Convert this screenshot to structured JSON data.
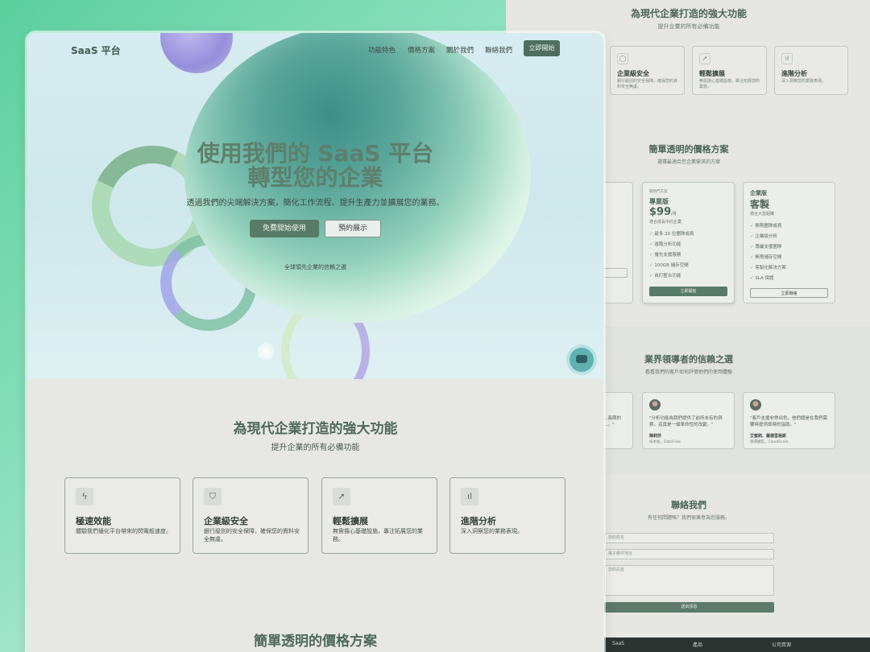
{
  "background_page": {
    "features": {
      "title": "為現代企業打造的強大功能",
      "subtitle": "提升企業的所有必備功能",
      "cards": [
        {
          "icon": "shield-icon",
          "title": "企業級安全",
          "desc": "銀行級別的安全保障，確保您的資料安全無虞。"
        },
        {
          "icon": "rocket-icon",
          "title": "輕鬆擴展",
          "desc": "無需擔心基礎設施，專注拓展您的業務。"
        },
        {
          "icon": "chart-icon",
          "title": "進階分析",
          "desc": "深入洞察您的業務表現。"
        }
      ]
    },
    "pricing": {
      "title": "簡單透明的價格方案",
      "subtitle": "選擇最適合您企業需求的方案",
      "pro": {
        "tag": "最熱門方案",
        "name": "專業版",
        "price": "$99",
        "period": "/月",
        "desc": "適合成長中的企業",
        "features": [
          "最多 20 位團隊成員",
          "進階分析功能",
          "優先支援服務",
          "100GB 儲存空間",
          "自訂整合功能"
        ],
        "cta": "立即開始"
      },
      "enterprise": {
        "name": "企業版",
        "price": "客製",
        "desc": "適合大型組織",
        "features": [
          "無限團隊成員",
          "企業級分析",
          "專屬支援團隊",
          "無限儲存空間",
          "客製化解決方案",
          "SLA 保證"
        ],
        "cta": "立即聯絡"
      }
    },
    "testimonials": {
      "title": "業界領導者的信賴之選",
      "subtitle": "看看我們的客戶如何評價他們的使用體驗",
      "partial_quote": "…長期的\n…。\"",
      "items": [
        {
          "quote": "\"分析功能為我們提供了前所未有的洞察，這真是一個革命性的改變。\"",
          "name": "陳莉莎",
          "company": "技術長，DataFlow"
        },
        {
          "quote": "\"客戶支援非常出色。他們總是在我們需要時提供即時的協助。\"",
          "name": "艾蜜莉、羅德里格斯",
          "company": "營運總監，CloudScale"
        }
      ]
    },
    "contact": {
      "title": "聯絡我們",
      "subtitle": "有任何問題嗎？我們很樂意為您服務。",
      "name_placeholder": "您的姓名",
      "email_placeholder": "電子郵件地址",
      "message_placeholder": "您的訊息",
      "submit": "送出訊息"
    },
    "footer": {
      "col1": "SaaS",
      "col2": "產品",
      "col3": "公司資源"
    }
  },
  "nav": {
    "brand": "SaaS 平台",
    "links": [
      "功能特色",
      "價格方案",
      "關於我們",
      "聯絡我們"
    ],
    "cta": "立即開始"
  },
  "hero": {
    "title_line1": "使用我們的 SaaS 平台",
    "title_line2": "轉型您的企業",
    "subtitle": "透過我們的尖端解決方案，簡化工作流程、提升生產力並擴展您的業務。",
    "primary_button": "免費開始使用",
    "secondary_button": "預約展示",
    "trust_text": "全球領先企業的信賴之選"
  },
  "features": {
    "title": "為現代企業打造的強大功能",
    "subtitle": "提升企業的所有必備功能",
    "cards": [
      {
        "icon": "lightning-icon",
        "title": "極速效能",
        "desc": "體驗我們優化平台帶來的閃電般速度。"
      },
      {
        "icon": "shield-icon",
        "title": "企業級安全",
        "desc": "銀行級別的安全保障，確保您的資料安全無虞。"
      },
      {
        "icon": "rocket-icon",
        "title": "輕鬆擴展",
        "desc": "無需擔心基礎設施，專注拓展您的業務。"
      },
      {
        "icon": "chart-icon",
        "title": "進階分析",
        "desc": "深入洞察您的業務表現。"
      }
    ]
  },
  "pricing": {
    "title": "簡單透明的價格方案"
  },
  "colors": {
    "accent": "#587a68",
    "chat": "#5fb2b1",
    "heading": "#4f6a5c"
  }
}
